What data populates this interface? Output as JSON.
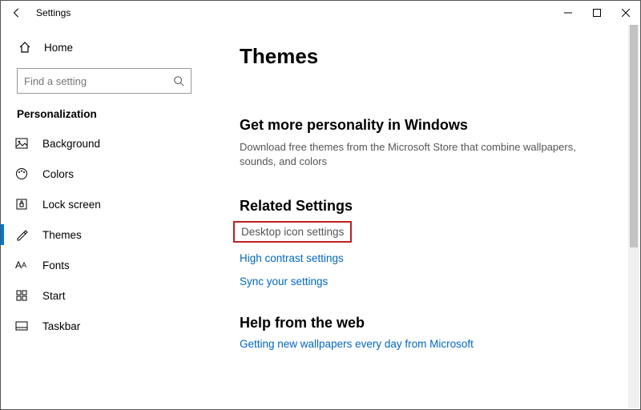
{
  "window": {
    "title": "Settings"
  },
  "sidebar": {
    "home": "Home",
    "search_placeholder": "Find a setting",
    "section": "Personalization",
    "items": [
      {
        "label": "Background"
      },
      {
        "label": "Colors"
      },
      {
        "label": "Lock screen"
      },
      {
        "label": "Themes"
      },
      {
        "label": "Fonts"
      },
      {
        "label": "Start"
      },
      {
        "label": "Taskbar"
      }
    ]
  },
  "content": {
    "title": "Themes",
    "more_heading": "Get more personality in Windows",
    "more_desc": "Download free themes from the Microsoft Store that combine wallpapers, sounds, and colors",
    "related_heading": "Related Settings",
    "link_desktop_icon": "Desktop icon settings",
    "link_high_contrast": "High contrast settings",
    "link_sync": "Sync your settings",
    "help_heading": "Help from the web",
    "link_wallpapers": "Getting new wallpapers every day from Microsoft"
  }
}
